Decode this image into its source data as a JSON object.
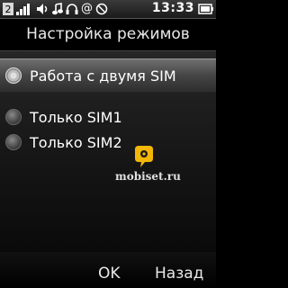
{
  "status_bar": {
    "time": "13:33",
    "icons": [
      "line-2-icon",
      "signal-icon",
      "sound-icon",
      "headset-icon",
      "at-icon",
      "silent-icon",
      "battery-icon"
    ],
    "line_number": "2"
  },
  "screen": {
    "title": "Настройка режимов"
  },
  "options": [
    {
      "label": "Работа с двумя SIM",
      "selected": true
    },
    {
      "label": "Только SIM1",
      "selected": false
    },
    {
      "label": "Только SIM2",
      "selected": false
    }
  ],
  "watermark": {
    "text": "mobiset.ru"
  },
  "softkeys": {
    "left": "OK",
    "right": "Назад"
  },
  "colors": {
    "background": "#000000",
    "highlight": "#5a5a5a",
    "logo_yellow": "#f2b705"
  }
}
